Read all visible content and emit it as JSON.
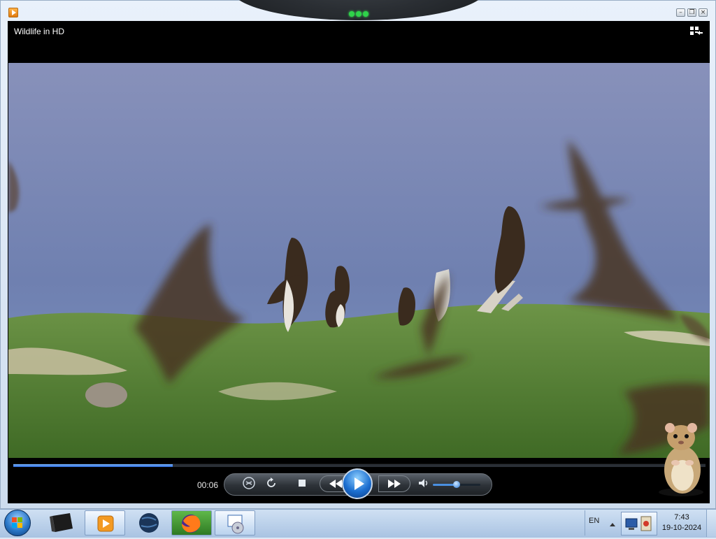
{
  "window": {
    "app_icon": "media-player-icon",
    "video_title": "Wildlife in HD",
    "caption_buttons": [
      "minimize",
      "restore",
      "close"
    ],
    "view_mode_icon": "switch-to-library-icon"
  },
  "playback": {
    "elapsed": "00:06",
    "progress_fraction": 0.23,
    "volume_fraction": 0.5,
    "state": "paused",
    "controls": [
      "shuffle",
      "repeat",
      "stop",
      "previous",
      "play",
      "next",
      "mute",
      "volume"
    ]
  },
  "taskbar": {
    "start_icon": "windows-start-orb",
    "apps": [
      "terminal-icon",
      "media-player-icon",
      "globe-icon",
      "firefox-icon",
      "media-center-icon"
    ],
    "language": "EN",
    "clock_time": "7:43",
    "clock_date": "19-10-2024"
  },
  "colors": {
    "accent": "#2a66d8",
    "sky": "#7f89b3",
    "grass": "#4f7a2e"
  }
}
